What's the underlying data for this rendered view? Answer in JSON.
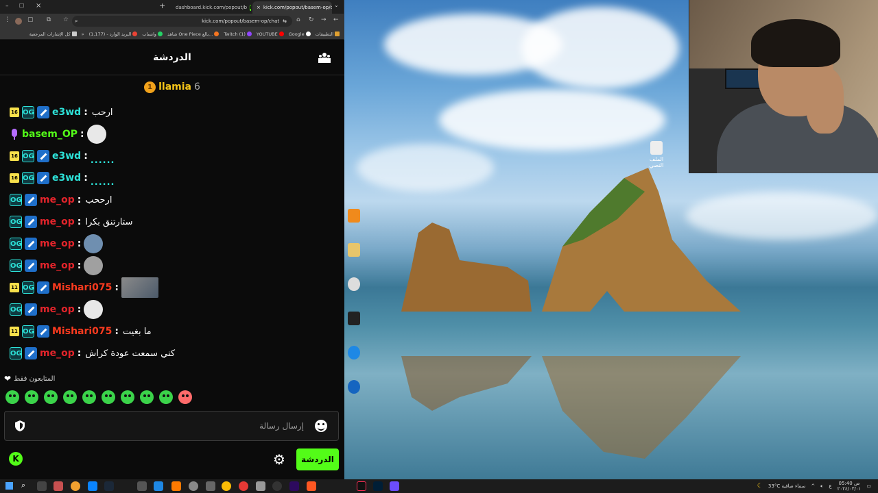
{
  "browser": {
    "tabs": [
      {
        "label": "dashboard.kick.com/popout/b"
      },
      {
        "label": "kick.com/popout/basem-op/ch"
      }
    ],
    "url": "kick.com/popout/basem-op/chat",
    "bookmarks": [
      {
        "label": "التطبيقات",
        "icon": "apps-grid-icon",
        "color": "#e0a030"
      },
      {
        "label": "Google",
        "icon": "google-icon",
        "color": "#ffffff"
      },
      {
        "label": "YOUTUBE",
        "icon": "youtube-icon",
        "color": "#ff0000"
      },
      {
        "label": "Twitch (1)",
        "icon": "twitch-icon",
        "color": "#9146ff"
      },
      {
        "label": "شاهد One Piece بالع...",
        "icon": "crunchyroll-icon",
        "color": "#f47521"
      },
      {
        "label": "واتساب",
        "icon": "whatsapp-icon",
        "color": "#25d366"
      },
      {
        "label": "البريد الوارد - (1,177)",
        "icon": "gmail-icon",
        "color": "#ea4335"
      },
      {
        "label": "»",
        "icon": "more-icon",
        "color": "#cccccc"
      },
      {
        "label": "كل الإشارات المرجعية",
        "icon": "folder-icon",
        "color": "#cccccc"
      }
    ]
  },
  "chat": {
    "title": "الدردشة",
    "pinned": {
      "coin": "1",
      "name": "llamia",
      "count": "6"
    },
    "followers_only": "المتابعون فقط",
    "input_placeholder": "إرسال رسالة",
    "send_label": "الدردشة",
    "logo_letter": "K",
    "messages": [
      {
        "badge": "16",
        "user": "e3wd",
        "color": "#2de2d8",
        "text": "ارحب",
        "kind": "text"
      },
      {
        "badge": "",
        "user": "basem_OP",
        "color": "#53fc18",
        "text": "",
        "kind": "emote"
      },
      {
        "badge": "16",
        "user": "e3wd",
        "color": "#2de2d8",
        "text": "......",
        "kind": "dots"
      },
      {
        "badge": "16",
        "user": "e3wd",
        "color": "#2de2d8",
        "text": "......",
        "kind": "dots"
      },
      {
        "badge": "",
        "user": "me_op",
        "color": "#e3242b",
        "text": "ارححب",
        "kind": "text"
      },
      {
        "badge": "",
        "user": "me_op",
        "color": "#e3242b",
        "text": "ستارتنق بكرا",
        "kind": "text"
      },
      {
        "badge": "",
        "user": "me_op",
        "color": "#e3242b",
        "text": "",
        "kind": "emote"
      },
      {
        "badge": "",
        "user": "me_op",
        "color": "#e3242b",
        "text": "",
        "kind": "emote"
      },
      {
        "badge": "11",
        "user": "Mishari075",
        "color": "#ff3b1f",
        "text": "",
        "kind": "thumb"
      },
      {
        "badge": "",
        "user": "me_op",
        "color": "#e3242b",
        "text": "",
        "kind": "emote"
      },
      {
        "badge": "11",
        "user": "Mishari075",
        "color": "#ff3b1f",
        "text": "ما بغيت",
        "kind": "text"
      },
      {
        "badge": "",
        "user": "me_op",
        "color": "#e3242b",
        "text": "كني سمعت عودة كراش",
        "kind": "text"
      }
    ]
  },
  "taskbar": {
    "weather": "33°C سماء صافية",
    "time": "05:40 ص",
    "date": "٢٠٢٤/٠٣/٠١",
    "lang": "ع"
  },
  "desktop": {
    "file_label": "الملف النصي"
  },
  "colors": {
    "kick_green": "#53fc18",
    "background": "#0b0b0b"
  }
}
